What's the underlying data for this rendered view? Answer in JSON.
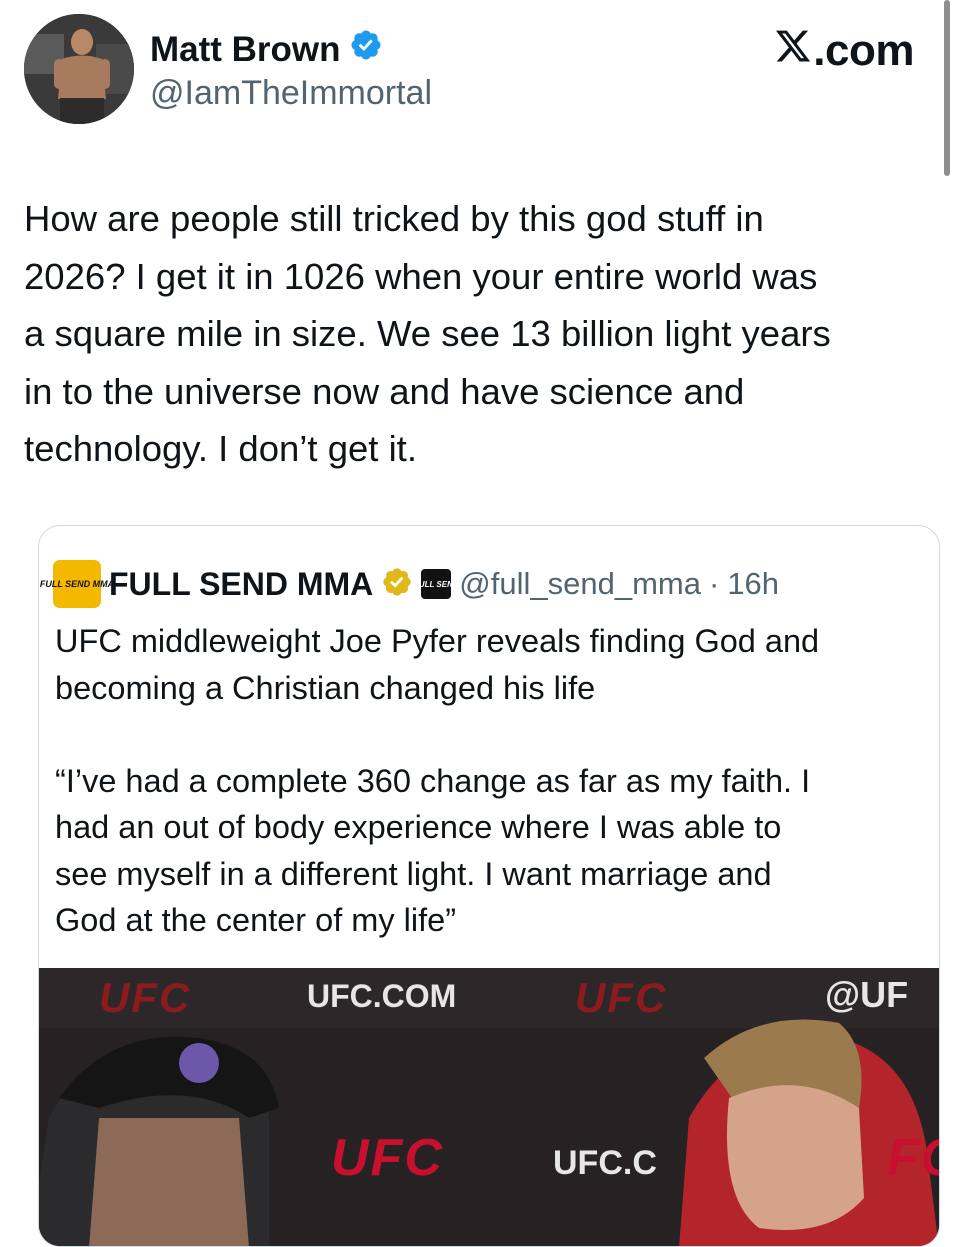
{
  "author": {
    "name": "Matt Brown",
    "handle": "@IamTheImmortal",
    "verified": true,
    "avatar_icon": "fighter-avatar"
  },
  "brand": {
    "label": ".com",
    "icon": "x-logo-icon"
  },
  "tweet": {
    "text": "How are people still tricked by this god stuff in\n2026? I get it in 1026 when your entire world was\na square mile in size. We see 13 billion light years\nin to the universe now and have science and\ntechnology. I don’t get it."
  },
  "quote": {
    "name": "FULL SEND MMA",
    "logo_text": "FULL SEND MMA",
    "badge_text": "FULL SEND",
    "handle": "@full_send_mma",
    "separator": "·",
    "time": "16h",
    "text": "UFC middleweight Joe Pyfer reveals finding God and\nbecoming a Christian changed his life\n\n“I’ve had a complete 360 change as far as my faith. I\nhad an out of body experience where I was able to\nsee myself in a different light. I want marriage and\nGod at the center of my life”",
    "media": {
      "backdrop_texts": [
        "UFC",
        "UFC.COM",
        "UFC",
        "@UF",
        "UFC",
        "UFC.C",
        "FC"
      ]
    }
  },
  "colors": {
    "verified_blue": "#1d9bf0",
    "gold_check": "#e2b719",
    "ufc_red": "#c8102e",
    "hoodie_red": "#b3242b"
  }
}
